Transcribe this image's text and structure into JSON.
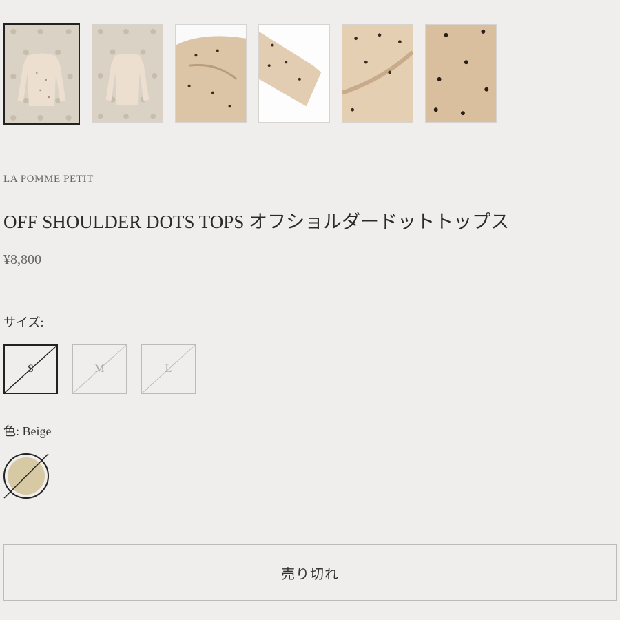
{
  "gallery": {
    "thumbnails": [
      {
        "name": "product-image-front-pattern-bg",
        "active": true
      },
      {
        "name": "product-image-back-pattern-bg",
        "active": false
      },
      {
        "name": "product-image-detail-shoulder",
        "active": false
      },
      {
        "name": "product-image-detail-sleeve",
        "active": false
      },
      {
        "name": "product-image-detail-gather",
        "active": false
      },
      {
        "name": "product-image-detail-fabric",
        "active": false
      }
    ]
  },
  "product": {
    "vendor": "LA POMME PETIT",
    "title": "OFF SHOULDER DOTS TOPS オフショルダードットトップス",
    "price": "¥8,800"
  },
  "options": {
    "size_label": "サイズ:",
    "sizes": [
      {
        "label": "S",
        "selected": true,
        "available": false
      },
      {
        "label": "M",
        "selected": false,
        "available": false
      },
      {
        "label": "L",
        "selected": false,
        "available": false
      }
    ],
    "color_label": "色:",
    "color_value": "Beige",
    "color_swatch": "#d6c9a3"
  },
  "cta": {
    "label": "売り切れ"
  },
  "colors": {
    "background": "#efeeec",
    "selected_border": "#222222",
    "disabled_border": "#bdbbb8"
  }
}
